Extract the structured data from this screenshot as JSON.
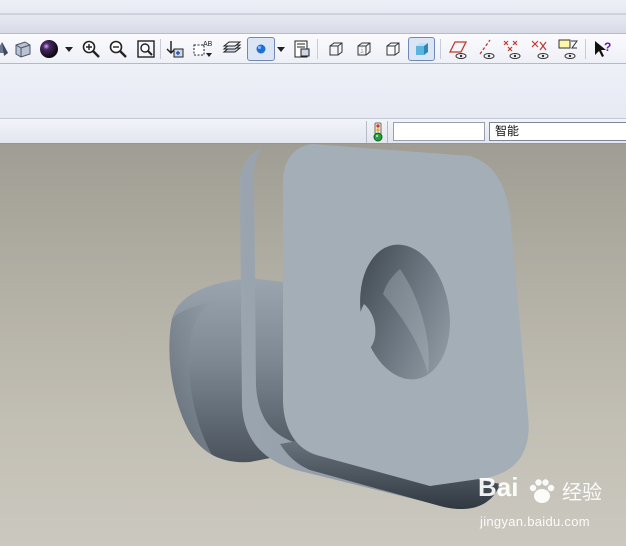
{
  "toolbar": {
    "buttons": [
      {
        "name": "orient-icon"
      },
      {
        "name": "appearance-sphere-icon"
      },
      {
        "name": "zoom-in-icon"
      },
      {
        "name": "zoom-out-icon"
      },
      {
        "name": "refit-icon"
      },
      {
        "name": "datum-display-icon"
      },
      {
        "name": "annotation-display-icon"
      },
      {
        "name": "layers-icon"
      },
      {
        "name": "display-style-icon"
      },
      {
        "name": "saved-views-icon"
      },
      {
        "name": "wireframe-icon"
      },
      {
        "name": "hidden-line-icon"
      },
      {
        "name": "no-hidden-icon"
      },
      {
        "name": "shading-icon"
      },
      {
        "name": "datum-planes-icon"
      },
      {
        "name": "datum-axes-icon"
      },
      {
        "name": "datum-points-icon"
      },
      {
        "name": "coordinate-systems-icon"
      },
      {
        "name": "annotations-icon"
      },
      {
        "name": "context-help-icon"
      }
    ],
    "active_colors": {
      "sphere": "#111111",
      "display_style": "#1f6fd6",
      "shading": "#3aa0cc"
    }
  },
  "statusbar": {
    "regen_icon": "regen-status-icon",
    "message_value": "",
    "filter_value": "智能"
  },
  "watermark": {
    "brand": "Bai",
    "brand_cn": "经验",
    "url": "jingyan.baidu.com"
  }
}
